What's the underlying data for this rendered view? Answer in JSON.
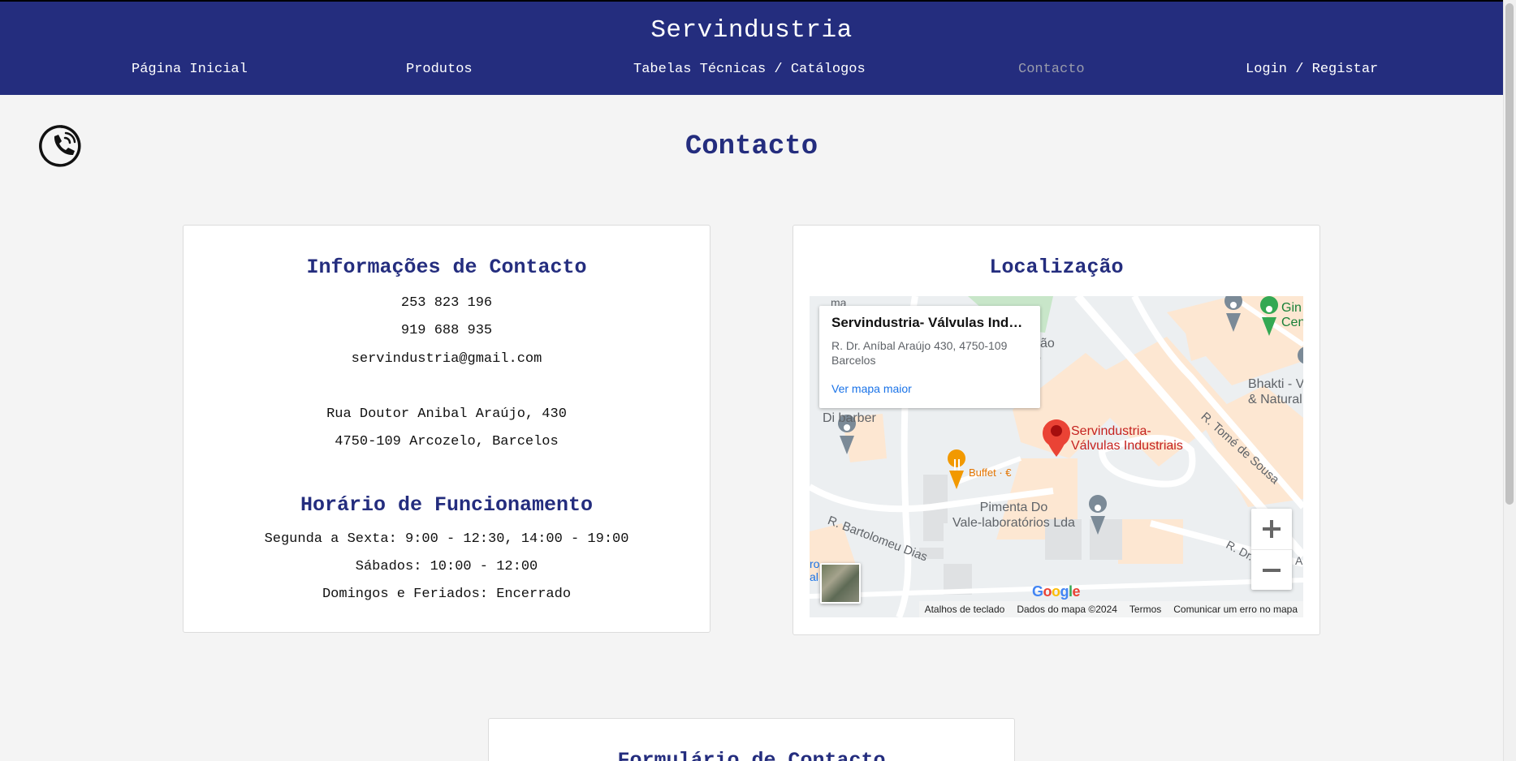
{
  "header": {
    "site_title": "Servindustria",
    "nav": [
      {
        "label": "Página Inicial",
        "active": false
      },
      {
        "label": "Produtos",
        "active": false
      },
      {
        "label": "Tabelas Técnicas / Catálogos",
        "active": false
      },
      {
        "label": "Contacto",
        "active": true
      },
      {
        "label": "Login / Registar",
        "active": false
      }
    ]
  },
  "page": {
    "title": "Contacto",
    "icon": "phone-icon"
  },
  "contact_card": {
    "title": "Informações de Contacto",
    "phone1": "253 823 196",
    "phone2": "919 688 935",
    "email": "servindustria@gmail.com",
    "address_line1": "Rua Doutor Anibal Araújo, 430",
    "address_line2": "4750-109 Arcozelo, Barcelos",
    "hours_title": "Horário de Funcionamento",
    "hours_weekdays": "Segunda a Sexta: 9:00 - 12:30, 14:00 - 19:00",
    "hours_saturday": "Sábados: 10:00 - 12:00",
    "hours_sunday": "Domingos e Feriados: Encerrado"
  },
  "location_card": {
    "title": "Localização",
    "map": {
      "info_title": "Servindustria- Válvulas Indust...",
      "info_address_line1": "R. Dr. Aníbal Araújo 430, 4750-109",
      "info_address_line2": "Barcelos",
      "info_link": "Ver mapa maior",
      "marker_label_line1": "Servindustria-",
      "marker_label_line2": "Válvulas Industriais",
      "poi_barber": "Di barber",
      "poi_buffet": "Buffet · €",
      "poi_pimenta_line1": "Pimenta Do",
      "poi_pimenta_line2": "Vale-laboratórios Lda",
      "poi_bhakti_line1": "Bhakti - V",
      "poi_bhakti_line2": "& Natural S",
      "poi_gin_line1": "Gin",
      "poi_gin_line2": "Cen",
      "poi_cao_line1": "ção",
      "poi_cao_line2": "o",
      "street_bartolomeu": "R. Bartolomeu Dias",
      "street_tome": "R. Tomé de Sousa",
      "street_dr": "R. Dr.",
      "street_a": "A",
      "street_ma": "ma",
      "edge_ro": "ro",
      "edge_al": "al",
      "google": "Google",
      "attribution": [
        "Atalhos de teclado",
        "Dados do mapa ©2024",
        "Termos",
        "Comunicar um erro no mapa"
      ],
      "zoom_in": "zoom-in-icon",
      "zoom_out": "zoom-out-icon",
      "colors": {
        "marker": "#ea4335",
        "marker_text": "#c5221f",
        "park": "#c8e6c9",
        "building": "#fde7d2",
        "road": "#ffffff"
      }
    }
  },
  "form_card": {
    "title": "Formulário de Contacto"
  },
  "colors": {
    "brand_blue": "#242d7e",
    "background": "#f4f4f4",
    "nav_active": "#9a9cab"
  }
}
